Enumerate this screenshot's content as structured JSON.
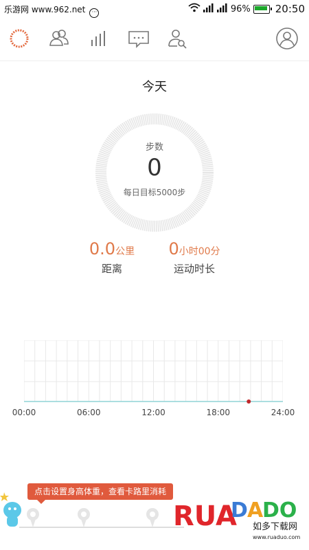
{
  "status_bar": {
    "site": "乐游网 www.962.net",
    "battery": "96%",
    "time": "20:50"
  },
  "nav": {
    "items": [
      {
        "icon": "activity-ring-icon",
        "active": true
      },
      {
        "icon": "friends-icon"
      },
      {
        "icon": "stats-bars-icon"
      },
      {
        "icon": "message-icon"
      },
      {
        "icon": "person-search-icon"
      },
      {
        "icon": "profile-icon"
      }
    ],
    "accent_color": "#e36a3f"
  },
  "today": {
    "title": "今天",
    "steps_label": "步数",
    "steps_value": "0",
    "goal_text": "每日目标5000步"
  },
  "stats": {
    "distance_value": "0.0",
    "distance_unit": "公里",
    "distance_label": "距离",
    "duration_hours": "0",
    "duration_hours_unit": "小时",
    "duration_minutes": "00",
    "duration_minutes_unit": "分",
    "duration_label": "运动时长"
  },
  "chart_data": {
    "type": "line",
    "title": "",
    "xlabel": "",
    "ylabel": "",
    "x_ticks": [
      "00:00",
      "06:00",
      "12:00",
      "18:00",
      "24:00"
    ],
    "series": [
      {
        "values": [
          0,
          0,
          0,
          0,
          0
        ]
      }
    ],
    "current_marker_time": "20:50",
    "grid": true
  },
  "tooltip": {
    "text": "点击设置身高体重，查看卡路里消耗"
  },
  "watermark": {
    "brand": "RUANDADO",
    "tagline": "如多下载网",
    "url": "www.ruaduo.com"
  }
}
